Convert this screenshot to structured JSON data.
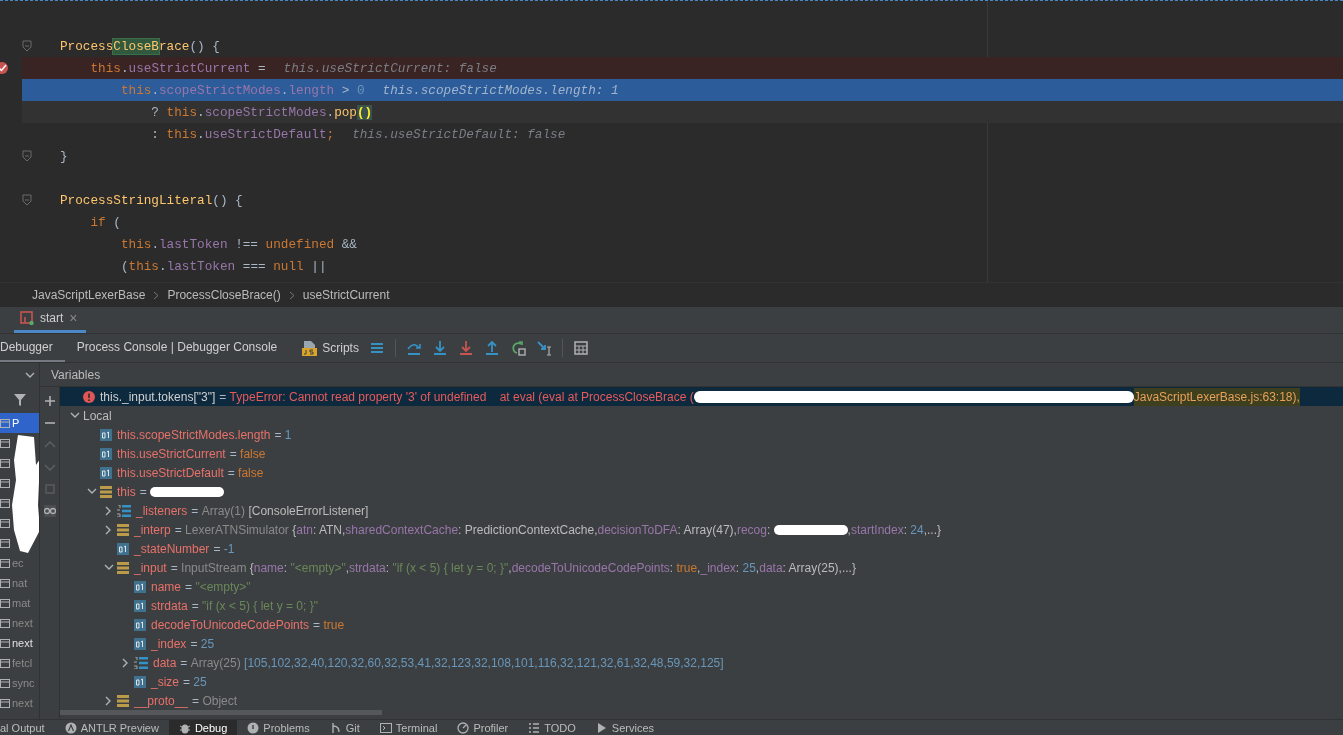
{
  "editor": {
    "lines": [
      {
        "kind": "blank"
      },
      {
        "kind": "code",
        "fold": true,
        "segments": [
          {
            "text": "Process",
            "kind": "method"
          },
          {
            "text": "CloseB",
            "kind": "match"
          },
          {
            "text": "race",
            "kind": "method"
          },
          {
            "text": "() {",
            "kind": "plain"
          }
        ]
      },
      {
        "kind": "code",
        "breakpoint": true,
        "segments": [
          {
            "text": "    this",
            "kind": "kw"
          },
          {
            "text": ".",
            "kind": "plain"
          },
          {
            "text": "useStrictCurrent",
            "kind": "field"
          },
          {
            "text": " =",
            "kind": "plain"
          }
        ],
        "hint": "this.useStrictCurrent: false"
      },
      {
        "kind": "code",
        "execution": true,
        "segments": [
          {
            "text": "        this",
            "kind": "kw"
          },
          {
            "text": ".",
            "kind": "plain"
          },
          {
            "text": "scopeStrictModes",
            "kind": "field"
          },
          {
            "text": ".",
            "kind": "plain"
          },
          {
            "text": "length",
            "kind": "field"
          },
          {
            "text": " > ",
            "kind": "plain"
          },
          {
            "text": "0",
            "kind": "num"
          }
        ],
        "hint": "this.scopeStrictModes.length: 1"
      },
      {
        "kind": "code",
        "caret_line": true,
        "segments": [
          {
            "text": "            ? ",
            "kind": "plain"
          },
          {
            "text": "this",
            "kind": "kw"
          },
          {
            "text": ".",
            "kind": "plain"
          },
          {
            "text": "scopeStrictModes",
            "kind": "field"
          },
          {
            "text": ".",
            "kind": "plain"
          },
          {
            "text": "pop",
            "kind": "method"
          },
          {
            "text": "()",
            "kind": "brace"
          }
        ]
      },
      {
        "kind": "code",
        "segments": [
          {
            "text": "            : ",
            "kind": "plain"
          },
          {
            "text": "this",
            "kind": "kw"
          },
          {
            "text": ".",
            "kind": "plain"
          },
          {
            "text": "useStrictDefault",
            "kind": "field"
          },
          {
            "text": ";",
            "kind": "kw"
          }
        ],
        "hint": "this.useStrictDefault: false"
      },
      {
        "kind": "code",
        "fold": true,
        "segments": [
          {
            "text": "}",
            "kind": "plain"
          }
        ]
      },
      {
        "kind": "blank"
      },
      {
        "kind": "code",
        "fold": true,
        "segments": [
          {
            "text": "ProcessStringLiteral",
            "kind": "method"
          },
          {
            "text": "() {",
            "kind": "plain"
          }
        ]
      },
      {
        "kind": "code",
        "segments": [
          {
            "text": "    if",
            "kind": "kw"
          },
          {
            "text": " (",
            "kind": "plain"
          }
        ]
      },
      {
        "kind": "code",
        "segments": [
          {
            "text": "        this",
            "kind": "kw"
          },
          {
            "text": ".",
            "kind": "plain"
          },
          {
            "text": "lastToken",
            "kind": "field"
          },
          {
            "text": " !== ",
            "kind": "plain"
          },
          {
            "text": "undefined",
            "kind": "kw"
          },
          {
            "text": " &&",
            "kind": "plain"
          }
        ]
      },
      {
        "kind": "code",
        "segments": [
          {
            "text": "        (",
            "kind": "plain"
          },
          {
            "text": "this",
            "kind": "kw"
          },
          {
            "text": ".",
            "kind": "plain"
          },
          {
            "text": "lastToken",
            "kind": "field"
          },
          {
            "text": " === ",
            "kind": "plain"
          },
          {
            "text": "null",
            "kind": "kw"
          },
          {
            "text": " ||",
            "kind": "plain"
          }
        ]
      }
    ]
  },
  "breadcrumbs": [
    "JavaScriptLexerBase",
    "ProcessCloseBrace()",
    "useStrictCurrent"
  ],
  "run_tabs": [
    {
      "label": "start",
      "selected": true,
      "close": "×"
    }
  ],
  "debug_tabs": [
    {
      "label": "Debugger",
      "selected": true
    },
    {
      "label": "Process Console | Debugger Console",
      "selected": false
    }
  ],
  "scripts_button": "Scripts",
  "frames": [
    {
      "label": "P",
      "selected": true
    },
    {
      "selected": false
    },
    {
      "selected": false
    },
    {
      "selected": false
    },
    {
      "selected": false
    },
    {
      "selected": false
    },
    {
      "selected": false
    },
    {
      "label": "ec",
      "selected": false
    },
    {
      "label": "nat",
      "selected": false
    },
    {
      "label": "mat",
      "selected": false
    },
    {
      "label": "next",
      "selected": false
    },
    {
      "label": "next",
      "selected": false,
      "current": true
    },
    {
      "label": "fetcl",
      "selected": false
    },
    {
      "label": "sync",
      "selected": false
    },
    {
      "label": "next",
      "selected": false
    }
  ],
  "variables": {
    "title": "Variables",
    "items": [
      {
        "kind": "error",
        "name": "this._input.tokens[\"3\"]",
        "selected": true,
        "value": [
          {
            "text": "= ",
            "kind": "op"
          },
          {
            "text": "TypeError: Cannot read property '3' of undefined    at eval (eval at ProcessCloseBrace (",
            "kind": "err"
          },
          {
            "kind": "redaction"
          },
          {
            "text": "JavaScriptLexerBase.js:63:18),",
            "kind": "errmark"
          }
        ]
      },
      {
        "kind": "scope",
        "name": "Local",
        "expanded": true,
        "children": [
          {
            "kind": "primitive",
            "name": "this.scopeStrictModes.length",
            "value": [
              {
                "text": "= ",
                "kind": "op"
              },
              {
                "text": "1",
                "kind": "num"
              }
            ]
          },
          {
            "kind": "primitive",
            "name": "this.useStrictCurrent",
            "value": [
              {
                "text": "= ",
                "kind": "op"
              },
              {
                "text": "false",
                "kind": "kw"
              }
            ]
          },
          {
            "kind": "primitive",
            "name": "this.useStrictDefault",
            "value": [
              {
                "text": "= ",
                "kind": "op"
              },
              {
                "text": "false",
                "kind": "kw"
              }
            ]
          },
          {
            "kind": "object",
            "name": "this",
            "expanded": true,
            "value": [
              {
                "text": "= ",
                "kind": "op"
              },
              {
                "kind": "redaction"
              }
            ],
            "children": [
              {
                "kind": "array",
                "name": "_listeners",
                "expanded": false,
                "value": [
                  {
                    "text": "= ",
                    "kind": "op"
                  },
                  {
                    "text": "Array(1) ",
                    "kind": "type"
                  },
                  {
                    "text": "[ConsoleErrorListener]",
                    "kind": "plain"
                  }
                ]
              },
              {
                "kind": "object",
                "name": "_interp",
                "expanded": false,
                "value": [
                  {
                    "text": "= ",
                    "kind": "op"
                  },
                  {
                    "text": "LexerATNSimulator ",
                    "kind": "type"
                  },
                  {
                    "text": "{",
                    "kind": "plain"
                  },
                  {
                    "text": "atn",
                    "kind": "field"
                  },
                  {
                    "text": ": ATN,",
                    "kind": "plain"
                  },
                  {
                    "text": "sharedContextCache",
                    "kind": "field"
                  },
                  {
                    "text": ": PredictionContextCache,",
                    "kind": "plain"
                  },
                  {
                    "text": "decisionToDFA",
                    "kind": "field"
                  },
                  {
                    "text": ": Array(47),",
                    "kind": "plain"
                  },
                  {
                    "text": "recog",
                    "kind": "field"
                  },
                  {
                    "text": ": ",
                    "kind": "plain"
                  },
                  {
                    "kind": "redaction"
                  },
                  {
                    "text": ",",
                    "kind": "plain"
                  },
                  {
                    "text": "startIndex",
                    "kind": "field"
                  },
                  {
                    "text": ": ",
                    "kind": "plain"
                  },
                  {
                    "text": "24",
                    "kind": "num"
                  },
                  {
                    "text": ",...}",
                    "kind": "plain"
                  }
                ]
              },
              {
                "kind": "primitive",
                "name": "_stateNumber",
                "value": [
                  {
                    "text": "= ",
                    "kind": "op"
                  },
                  {
                    "text": "-1",
                    "kind": "num"
                  }
                ]
              },
              {
                "kind": "object",
                "name": "_input",
                "expanded": true,
                "value": [
                  {
                    "text": "= ",
                    "kind": "op"
                  },
                  {
                    "text": "InputStream ",
                    "kind": "type"
                  },
                  {
                    "text": "{",
                    "kind": "plain"
                  },
                  {
                    "text": "name",
                    "kind": "field"
                  },
                  {
                    "text": ": ",
                    "kind": "plain"
                  },
                  {
                    "text": "\"<empty>\"",
                    "kind": "str"
                  },
                  {
                    "text": ",",
                    "kind": "plain"
                  },
                  {
                    "text": "strdata",
                    "kind": "field"
                  },
                  {
                    "text": ": ",
                    "kind": "plain"
                  },
                  {
                    "text": "\"if (x < 5) { let y = 0; }\"",
                    "kind": "str"
                  },
                  {
                    "text": ",",
                    "kind": "plain"
                  },
                  {
                    "text": "decodeToUnicodeCodePoints",
                    "kind": "field"
                  },
                  {
                    "text": ": ",
                    "kind": "plain"
                  },
                  {
                    "text": "true",
                    "kind": "kw"
                  },
                  {
                    "text": ",",
                    "kind": "plain"
                  },
                  {
                    "text": "_index",
                    "kind": "field"
                  },
                  {
                    "text": ": ",
                    "kind": "plain"
                  },
                  {
                    "text": "25",
                    "kind": "num"
                  },
                  {
                    "text": ",",
                    "kind": "plain"
                  },
                  {
                    "text": "data",
                    "kind": "field"
                  },
                  {
                    "text": ": Array(25),...}",
                    "kind": "plain"
                  }
                ],
                "children": [
                  {
                    "kind": "primitive",
                    "name": "name",
                    "value": [
                      {
                        "text": "= ",
                        "kind": "op"
                      },
                      {
                        "text": "\"<empty>\"",
                        "kind": "str"
                      }
                    ]
                  },
                  {
                    "kind": "primitive",
                    "name": "strdata",
                    "value": [
                      {
                        "text": "= ",
                        "kind": "op"
                      },
                      {
                        "text": "\"if (x < 5) { let y = 0; }\"",
                        "kind": "str"
                      }
                    ]
                  },
                  {
                    "kind": "primitive",
                    "name": "decodeToUnicodeCodePoints",
                    "value": [
                      {
                        "text": "= ",
                        "kind": "op"
                      },
                      {
                        "text": "true",
                        "kind": "kw"
                      }
                    ]
                  },
                  {
                    "kind": "primitive",
                    "name": "_index",
                    "value": [
                      {
                        "text": "= ",
                        "kind": "op"
                      },
                      {
                        "text": "25",
                        "kind": "num"
                      }
                    ]
                  },
                  {
                    "kind": "array",
                    "name": "data",
                    "expanded": false,
                    "value": [
                      {
                        "text": "= ",
                        "kind": "op"
                      },
                      {
                        "text": "Array(25) ",
                        "kind": "type"
                      },
                      {
                        "text": "[105,102,32,40,120,32,60,32,53,41,32,123,32,108,101,116,32,121,32,61,32,48,59,32,125]",
                        "kind": "num"
                      }
                    ]
                  },
                  {
                    "kind": "primitive",
                    "name": "_size",
                    "value": [
                      {
                        "text": "= ",
                        "kind": "op"
                      },
                      {
                        "text": "25",
                        "kind": "num"
                      }
                    ]
                  }
                ]
              },
              {
                "kind": "object",
                "name": "__proto__",
                "expanded": false,
                "value": [
                  {
                    "text": "= ",
                    "kind": "op"
                  },
                  {
                    "text": "Object",
                    "kind": "type"
                  }
                ]
              }
            ]
          }
        ]
      }
    ]
  },
  "tool_windows": [
    {
      "label": "al Output",
      "kind": "output",
      "selected": false
    },
    {
      "label": "ANTLR Preview",
      "kind": "antlr",
      "selected": false
    },
    {
      "label": "Debug",
      "kind": "debug",
      "selected": true
    },
    {
      "label": "Problems",
      "kind": "problems",
      "selected": false
    },
    {
      "label": "Git",
      "kind": "git",
      "selected": false
    },
    {
      "label": "Terminal",
      "kind": "terminal",
      "selected": false
    },
    {
      "label": "Profiler",
      "kind": "profiler",
      "selected": false
    },
    {
      "label": "TODO",
      "kind": "todo",
      "selected": false
    },
    {
      "label": "Services",
      "kind": "services",
      "selected": false
    }
  ]
}
